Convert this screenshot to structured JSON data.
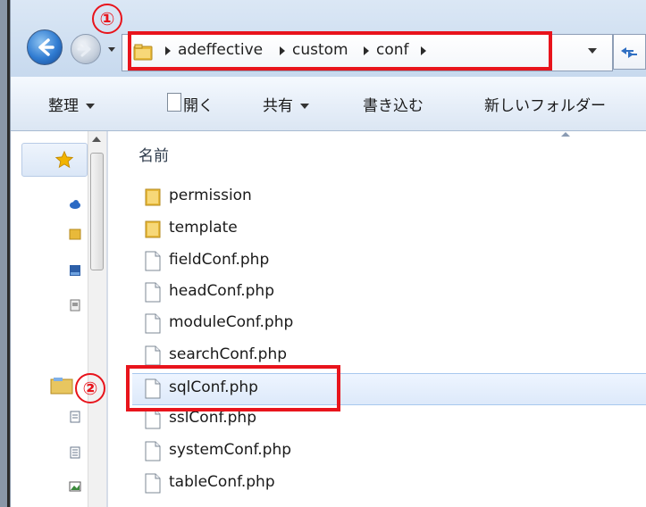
{
  "window": {
    "breadcrumbs": [
      "adeffective",
      "custom",
      "conf"
    ]
  },
  "toolbar": {
    "organize": "整理",
    "open": "開く",
    "share": "共有",
    "burn": "書き込む",
    "new_folder": "新しいフォルダー"
  },
  "file_list": {
    "column_name": "名前",
    "items": [
      {
        "name": "permission",
        "type": "folder"
      },
      {
        "name": "template",
        "type": "folder"
      },
      {
        "name": "fieldConf.php",
        "type": "file"
      },
      {
        "name": "headConf.php",
        "type": "file"
      },
      {
        "name": "moduleConf.php",
        "type": "file"
      },
      {
        "name": "searchConf.php",
        "type": "file"
      },
      {
        "name": "sqlConf.php",
        "type": "file",
        "selected": true
      },
      {
        "name": "sslConf.php",
        "type": "file"
      },
      {
        "name": "systemConf.php",
        "type": "file"
      },
      {
        "name": "tableConf.php",
        "type": "file"
      }
    ]
  },
  "annotations": {
    "marker_1": "①",
    "marker_2": "②",
    "highlight_color": "#e8141c"
  },
  "colors": {
    "selection": "#dde9fa",
    "folder": "#e8b93a"
  }
}
